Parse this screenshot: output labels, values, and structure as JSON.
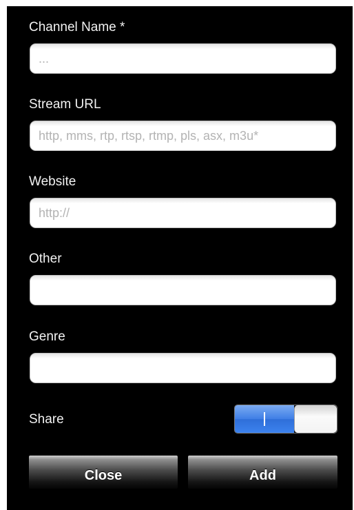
{
  "form": {
    "channel_name": {
      "label": "Channel Name *",
      "placeholder": "...",
      "value": ""
    },
    "stream_url": {
      "label": "Stream URL",
      "placeholder": "http, mms, rtp, rtsp, rtmp, pls, asx, m3u*",
      "value": ""
    },
    "website": {
      "label": "Website",
      "placeholder": "http://",
      "value": ""
    },
    "other": {
      "label": "Other",
      "placeholder": "",
      "value": ""
    },
    "genre": {
      "label": "Genre",
      "placeholder": "",
      "value": ""
    },
    "share": {
      "label": "Share",
      "on_label": "I",
      "state": "on"
    }
  },
  "buttons": {
    "close_label": "Close",
    "add_label": "Add"
  },
  "colors": {
    "background": "#000000",
    "toggle_on": "#3c82ee"
  }
}
